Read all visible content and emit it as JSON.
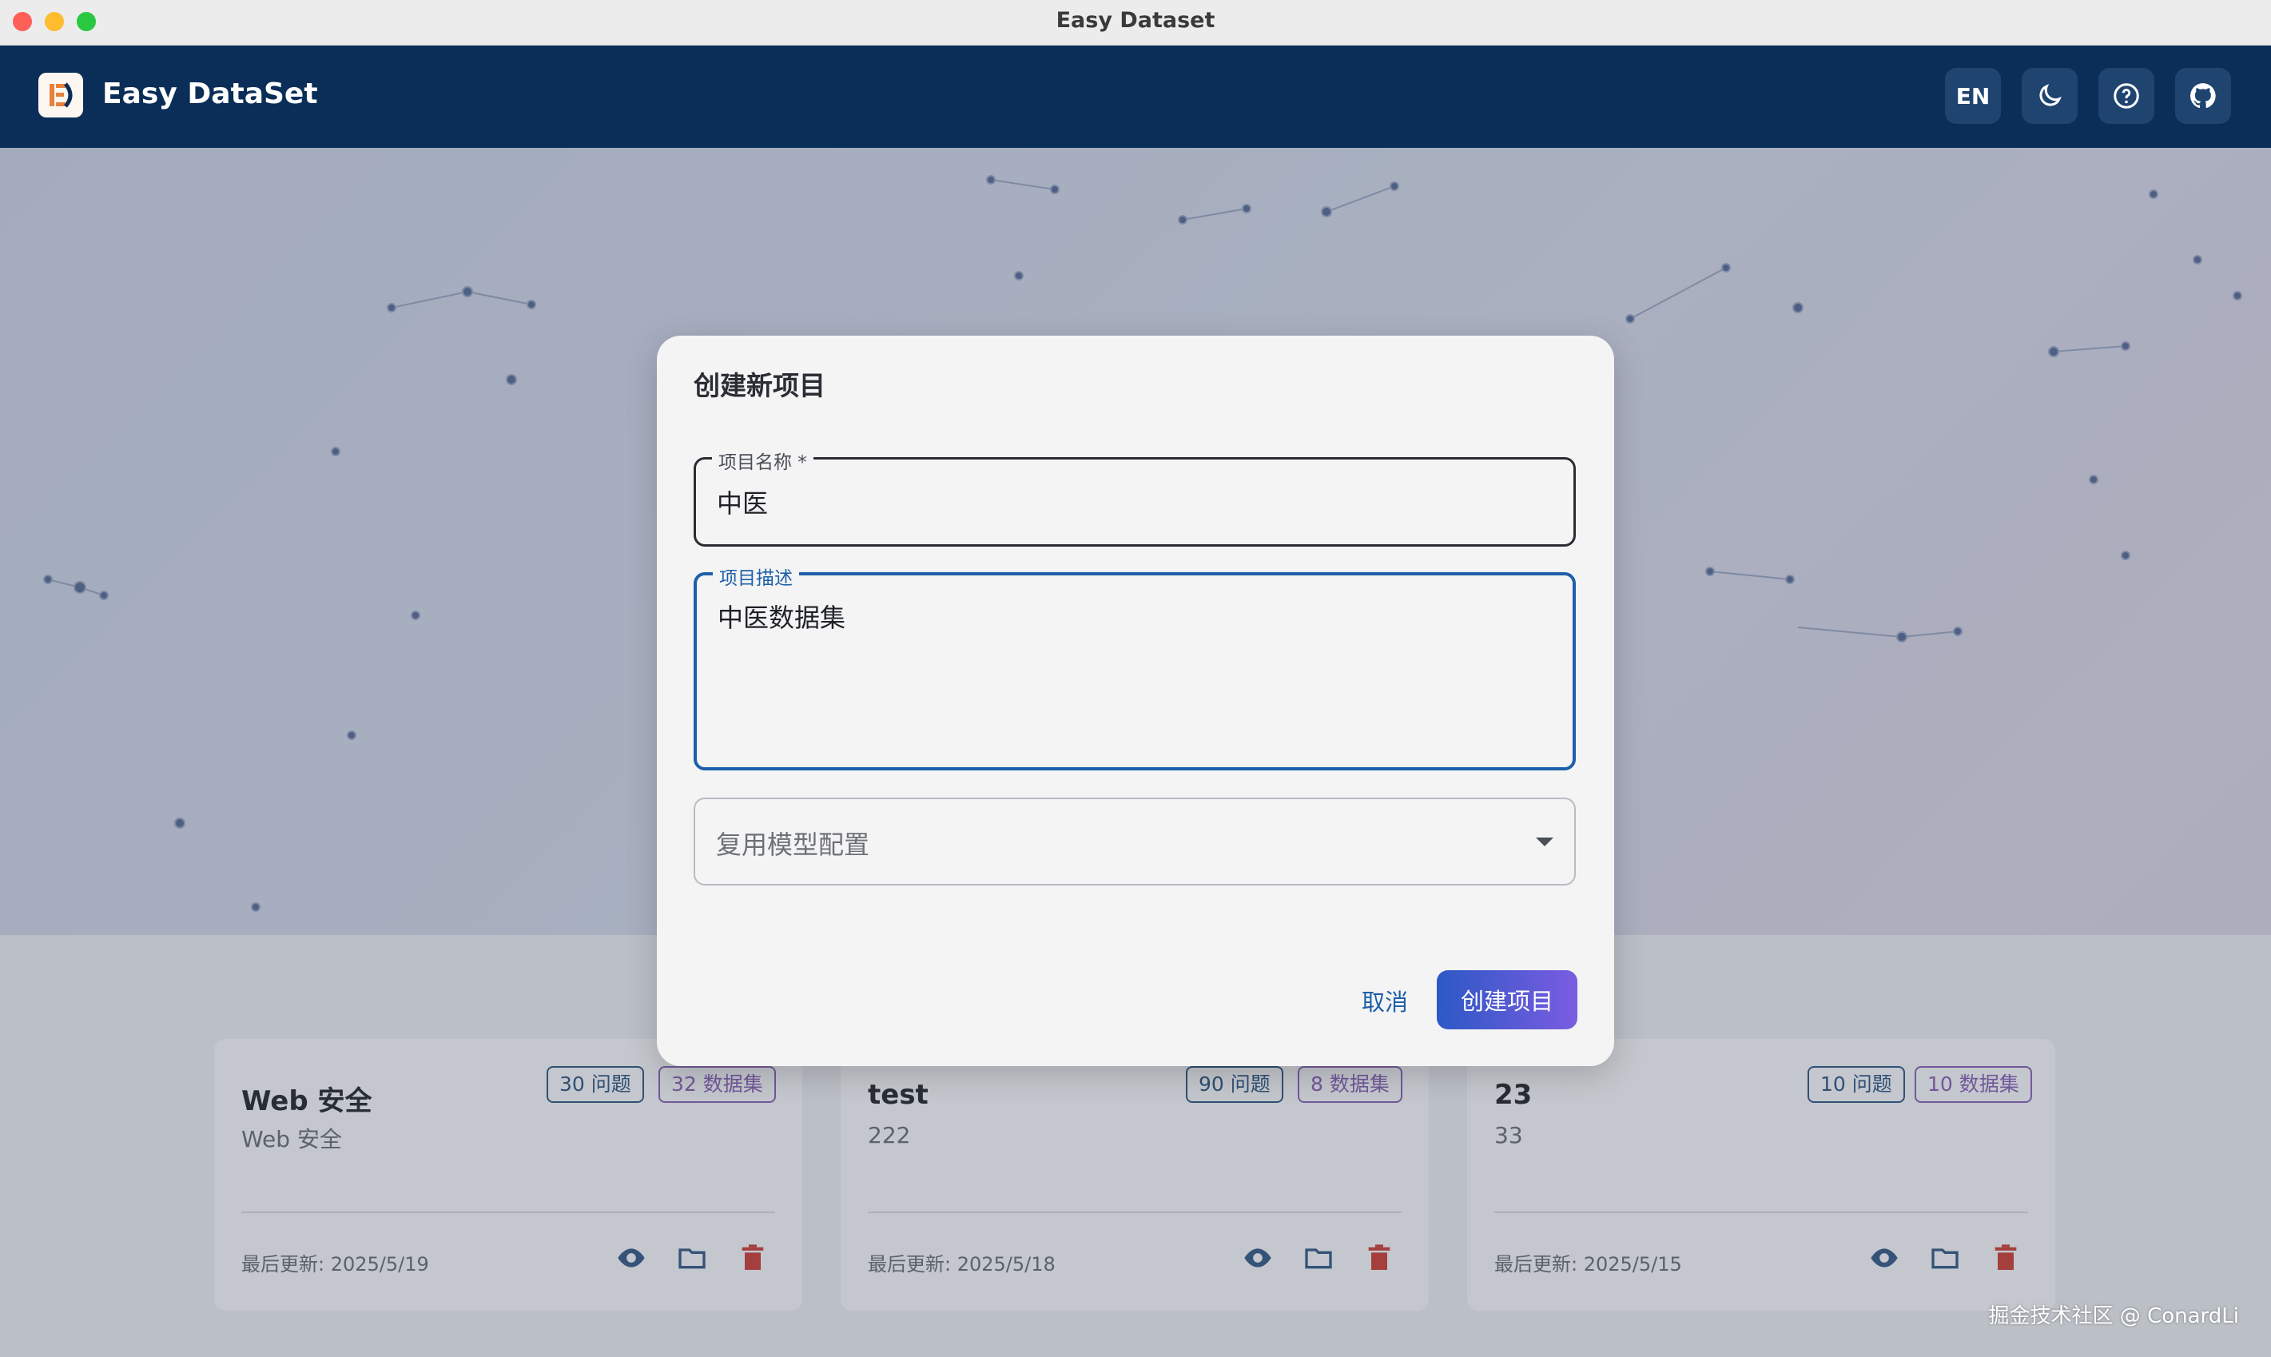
{
  "window": {
    "title": "Easy Dataset"
  },
  "header": {
    "brand": "Easy DataSet",
    "lang_label": "EN"
  },
  "projects": [
    {
      "name": "Web 安全",
      "description": "Web 安全",
      "questions": "30 问题",
      "datasets": "32 数据集",
      "updated": "最后更新: 2025/5/19"
    },
    {
      "name": "test",
      "description": "222",
      "questions": "90 问题",
      "datasets": "8 数据集",
      "updated": "最后更新: 2025/5/18"
    },
    {
      "name": "23",
      "description": "33",
      "questions": "10 问题",
      "datasets": "10 数据集",
      "updated": "最后更新: 2025/5/15"
    }
  ],
  "dialog": {
    "title": "创建新项目",
    "name_label": "项目名称 *",
    "name_value": "中医",
    "desc_label": "项目描述",
    "desc_value": "中医数据集",
    "model_placeholder": "复用模型配置",
    "cancel_label": "取消",
    "create_label": "创建项目"
  },
  "watermark": "掘金技术社区 @ ConardLi",
  "colors": {
    "appbar": "#0a2e57",
    "accent": "#1d5fa8",
    "create_gradient_start": "#2d58c6",
    "create_gradient_end": "#7b5ce0",
    "delete": "#d32f2f"
  }
}
